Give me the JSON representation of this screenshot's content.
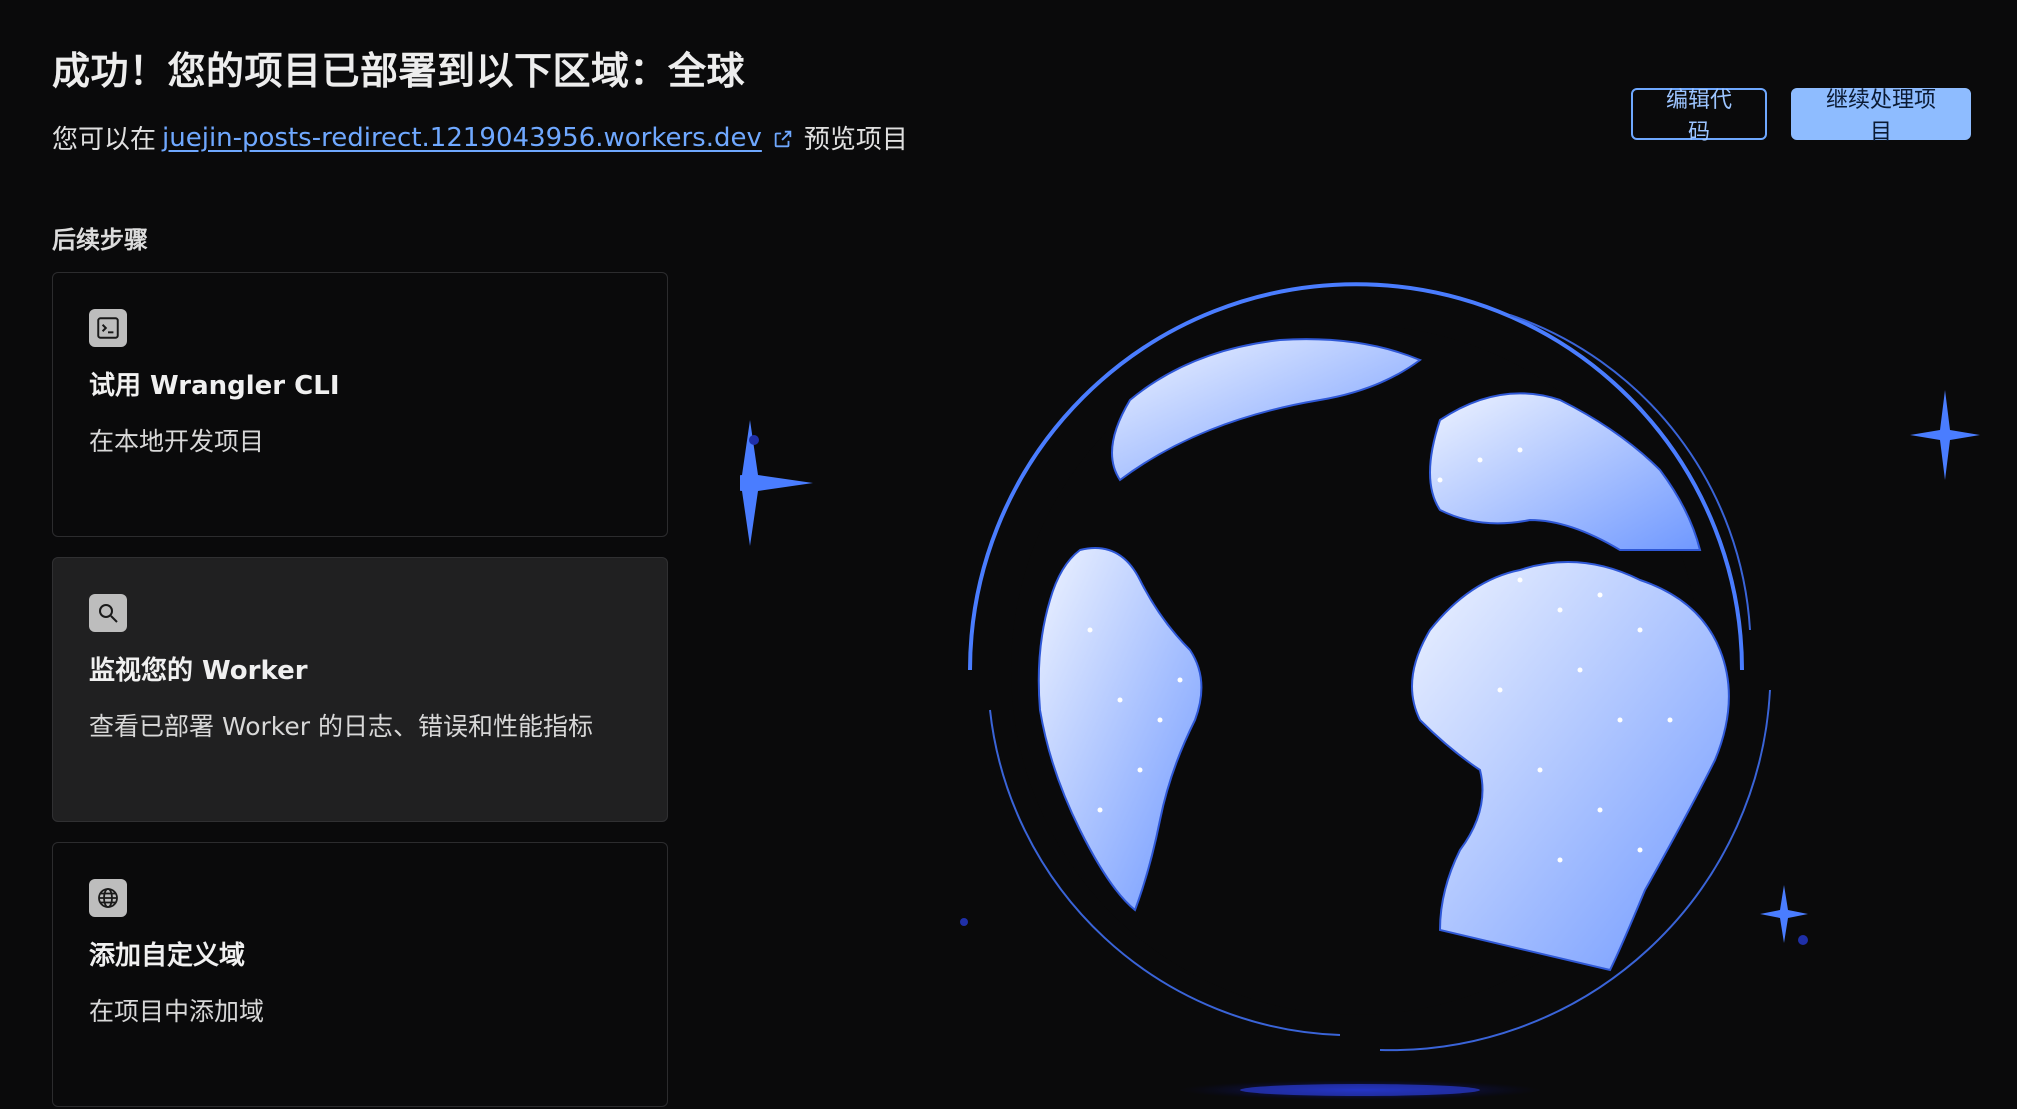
{
  "header": {
    "title": "成功！您的项目已部署到以下区域：全球",
    "subtitle_prefix": "您可以在",
    "link_text": "juejin-posts-redirect.1219043956.workers.dev",
    "subtitle_suffix": "预览项目"
  },
  "actions": {
    "edit_code_label": "编辑代码",
    "continue_label": "继续处理项目"
  },
  "steps": {
    "label": "后续步骤",
    "cards": [
      {
        "title": "试用 Wrangler CLI",
        "desc": "在本地开发项目",
        "icon": "terminal-icon"
      },
      {
        "title": "监视您的 Worker",
        "desc": "查看已部署 Worker 的日志、错误和性能指标",
        "icon": "search-icon"
      },
      {
        "title": "添加自定义域",
        "desc": "在项目中添加域",
        "icon": "globe-icon"
      }
    ]
  },
  "colors": {
    "accent": "#6fa8ff",
    "primary_button": "#8ebcff",
    "background": "#0a0a0b",
    "sparkle": "#4a7dff",
    "globe_light": "#dfe9ff",
    "globe_dark": "#7aa2ff"
  },
  "illustration": {
    "icon": "globe-illustration"
  }
}
